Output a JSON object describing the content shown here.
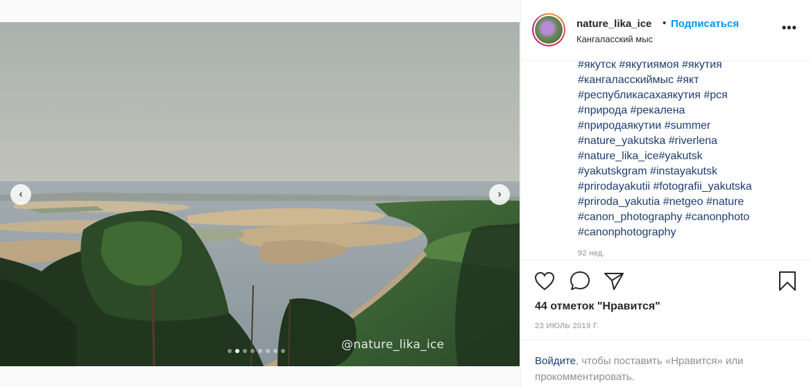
{
  "post": {
    "watermark": "@nature_lika_ice",
    "carousel": {
      "slides": 8,
      "active_index": 1
    },
    "nav": {
      "prev_icon": "chevron-left-icon",
      "next_icon": "chevron-right-icon"
    }
  },
  "header": {
    "username": "nature_lika_ice",
    "separator": "•",
    "follow_label": "Подписаться",
    "location": "Кангаласский мыс",
    "more_label": "•••"
  },
  "caption": {
    "lines": [
      "#якутск #якутиямоя #якутия",
      "#кангаласскиймыс #якт",
      "#республикасахаякутия #рся",
      "#природа #рекалена",
      "#природаякутии #summer",
      "#nature_yakutska #riverlena",
      "#nature_lika_ice#yakutsk",
      "#yakutskgram #instayakutsk",
      "#prirodayakutii #fotografii_yakutska",
      "#priroda_yakutia #netgeo #nature",
      "#canon_photography #canonphoto",
      "#canonphotography"
    ],
    "time_ago": "92 нед."
  },
  "actions": {
    "like_icon": "heart-icon",
    "comment_icon": "comment-icon",
    "share_icon": "paper-plane-icon",
    "save_icon": "bookmark-icon"
  },
  "likes_text": "44 отметок \"Нравится\"",
  "date_text": "23 ИЮЛЬ 2019 Г.",
  "login": {
    "link_label": "Войдите",
    "rest_text": ", чтобы поставить «Нравится» или прокомментировать."
  },
  "colors": {
    "accent": "#0095f6",
    "link": "#1c3d6e",
    "muted": "#8e8e8e",
    "text": "#262626"
  }
}
